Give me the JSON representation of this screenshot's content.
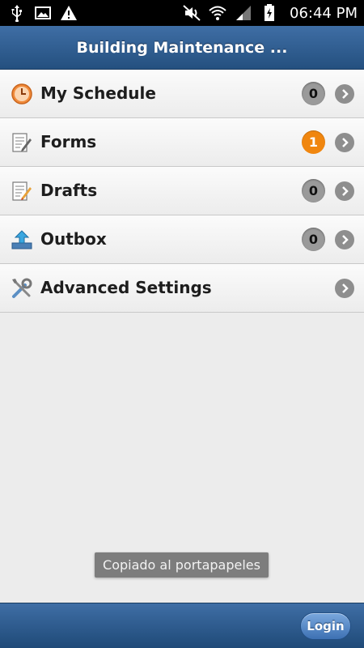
{
  "status_bar": {
    "time": "06:44 PM",
    "icons": [
      "usb-icon",
      "image-icon",
      "warning-icon",
      "mute-icon",
      "wifi-icon",
      "signal-icon",
      "battery-charging-icon"
    ]
  },
  "header": {
    "title": "Building Maintenance ..."
  },
  "menu": {
    "items": [
      {
        "label": "My Schedule",
        "badge": "0",
        "icon": "clock-icon"
      },
      {
        "label": "Forms",
        "badge": "1",
        "icon": "form-icon"
      },
      {
        "label": "Drafts",
        "badge": "0",
        "icon": "drafts-icon"
      },
      {
        "label": "Outbox",
        "badge": "0",
        "icon": "outbox-upload-icon"
      },
      {
        "label": "Advanced Settings",
        "icon": "tools-icon"
      }
    ]
  },
  "toast": {
    "text": "Copiado al portapapeles"
  },
  "footer": {
    "login_label": "Login"
  },
  "colors": {
    "header_blue": "#2f5d91",
    "badge_active": "#f0860f",
    "badge_zero": "#9a9a9a"
  }
}
